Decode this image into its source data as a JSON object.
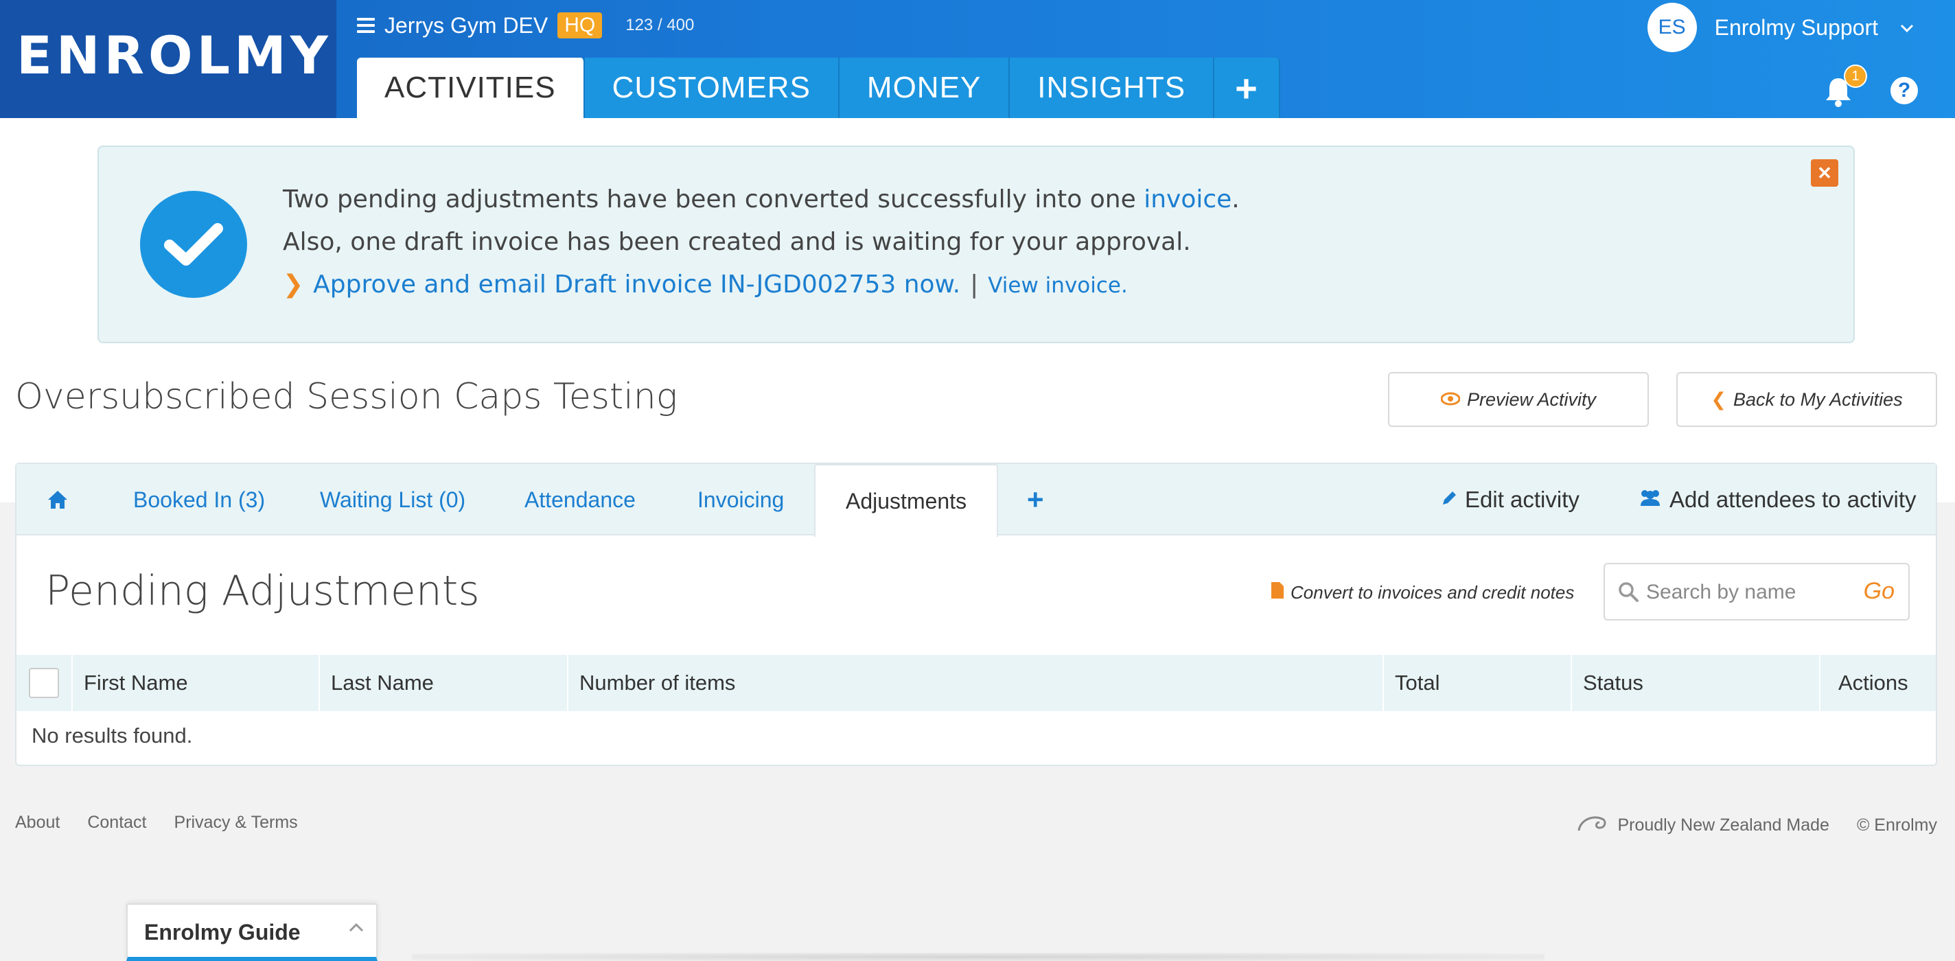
{
  "header": {
    "logo": "ENROLMY",
    "org_name": "Jerrys Gym DEV",
    "hq_badge": "HQ",
    "counter": "123 / 400",
    "tabs": [
      {
        "label": "ACTIVITIES"
      },
      {
        "label": "CUSTOMERS"
      },
      {
        "label": "MONEY"
      },
      {
        "label": "INSIGHTS"
      }
    ],
    "user_initials": "ES",
    "user_name": "Enrolmy Support",
    "notification_count": "1",
    "help": "?"
  },
  "alert": {
    "line1_prefix": "Two pending adjustments have been converted successfully into one ",
    "line1_link": "invoice",
    "line1_suffix": ".",
    "line2": "Also, one draft invoice has been created and is waiting for your approval.",
    "approve_link": "Approve and email Draft invoice IN-JGD002753 now.",
    "separator": "|",
    "view_link": "View invoice."
  },
  "page": {
    "title": "Oversubscribed Session Caps Testing",
    "preview_button": "Preview Activity",
    "back_button": "Back to My Activities"
  },
  "activity_tabs": [
    {
      "label": "Booked In (3)"
    },
    {
      "label": "Waiting List (0)"
    },
    {
      "label": "Attendance"
    },
    {
      "label": "Invoicing"
    },
    {
      "label": "Adjustments"
    }
  ],
  "activity_actions": {
    "edit": "Edit activity",
    "add_attendees": "Add attendees to activity"
  },
  "adjustments": {
    "title": "Pending Adjustments",
    "convert": "Convert to invoices and credit notes",
    "search_placeholder": "Search by name",
    "go": "Go",
    "columns": [
      "First Name",
      "Last Name",
      "Number of items",
      "Total",
      "Status",
      "Actions"
    ],
    "empty": "No results found."
  },
  "footer": {
    "links": [
      "About",
      "Contact",
      "Privacy & Terms"
    ],
    "made_in": "Proudly New Zealand Made",
    "copyright": "© Enrolmy"
  },
  "guide": {
    "title": "Enrolmy Guide"
  },
  "colors": {
    "brand_blue": "#1a78d6",
    "accent_orange": "#f08a24",
    "link_blue": "#1b7ed0"
  }
}
